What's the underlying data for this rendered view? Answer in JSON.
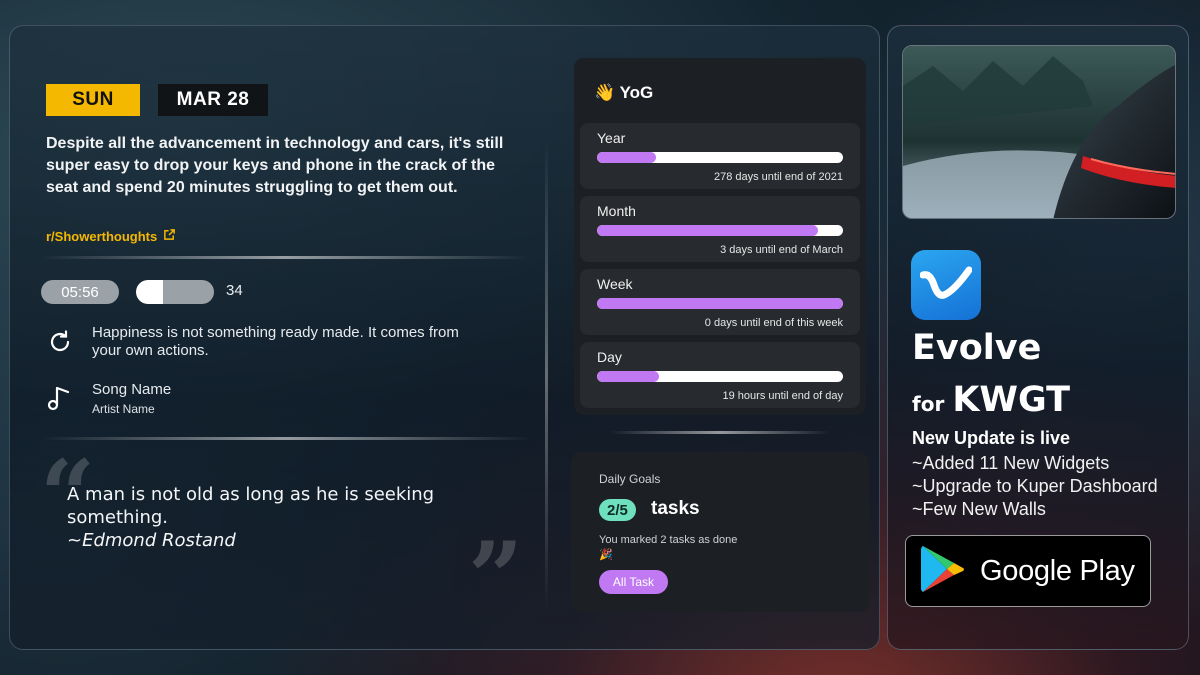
{
  "date": {
    "day": "SUN",
    "date": "MAR 28"
  },
  "thought": {
    "text": "Despite all the advancement in technology and cars, it's still super easy to drop your keys and phone in the crack of the seat and spend 20 minutes struggling to get them out.",
    "source": "r/Showerthoughts",
    "icon": "external-link-icon"
  },
  "status": {
    "time": "05:56",
    "battery": "34",
    "battery_level": 0.34
  },
  "daily_quote": {
    "text": "Happiness is not something ready made. It comes from your own actions.",
    "icon": "refresh-icon"
  },
  "music": {
    "song": "Song Name",
    "artist": "Artist Name",
    "icon": "music-note-icon"
  },
  "quote": {
    "text": "A man is not old as long as he is seeking something.",
    "author": "~Edmond Rostand"
  },
  "yog": {
    "title": "👋 YoG",
    "rows": [
      {
        "label": "Year",
        "progress": 0.24,
        "caption": "278 days until end of 2021"
      },
      {
        "label": "Month",
        "progress": 0.9,
        "caption": "3 days until end of March"
      },
      {
        "label": "Week",
        "progress": 1.0,
        "caption": "0 days until end of this week"
      },
      {
        "label": "Day",
        "progress": 0.25,
        "caption": "19 hours until end of day"
      }
    ],
    "progress_color": "#c079f2"
  },
  "goals": {
    "title": "Daily Goals",
    "count": "2/5",
    "unit": "tasks",
    "message": "You marked 2 tasks as done 🎉",
    "button": "All Task",
    "accent": "#6fe0bd"
  },
  "promo": {
    "app_name": "Evolve",
    "for": "for",
    "platform": "KWGT",
    "update_head": "New Update is live",
    "updates": [
      "~Added 11 New Widgets",
      "~Upgrade to Kuper Dashboard",
      "~Few New Walls"
    ],
    "store_button": "Google Play",
    "store_icon": "google-play-icon",
    "brand_color": "#1f8ee8"
  }
}
